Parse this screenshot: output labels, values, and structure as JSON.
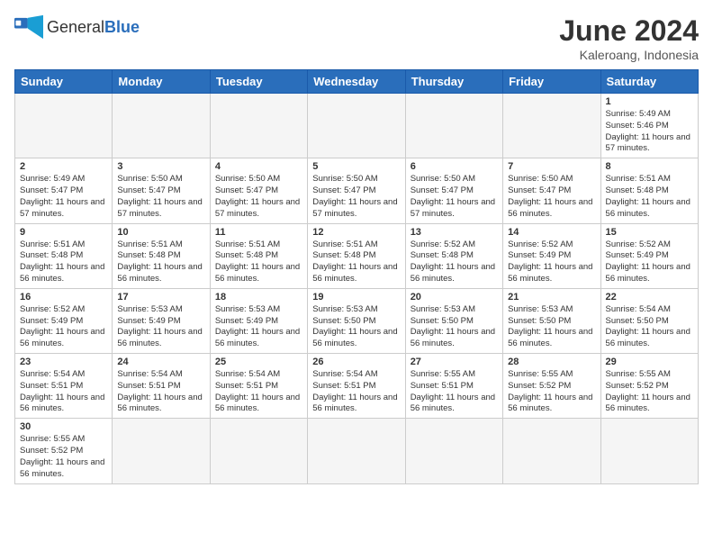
{
  "header": {
    "logo_text_normal": "General",
    "logo_text_bold": "Blue",
    "month_title": "June 2024",
    "subtitle": "Kaleroang, Indonesia"
  },
  "weekdays": [
    "Sunday",
    "Monday",
    "Tuesday",
    "Wednesday",
    "Thursday",
    "Friday",
    "Saturday"
  ],
  "weeks": [
    [
      {
        "day": "",
        "empty": true
      },
      {
        "day": "",
        "empty": true
      },
      {
        "day": "",
        "empty": true
      },
      {
        "day": "",
        "empty": true
      },
      {
        "day": "",
        "empty": true
      },
      {
        "day": "",
        "empty": true
      },
      {
        "day": "1",
        "sunrise": "5:49 AM",
        "sunset": "5:46 PM",
        "daylight": "11 hours and 57 minutes."
      }
    ],
    [
      {
        "day": "2",
        "sunrise": "5:49 AM",
        "sunset": "5:47 PM",
        "daylight": "11 hours and 57 minutes."
      },
      {
        "day": "3",
        "sunrise": "5:50 AM",
        "sunset": "5:47 PM",
        "daylight": "11 hours and 57 minutes."
      },
      {
        "day": "4",
        "sunrise": "5:50 AM",
        "sunset": "5:47 PM",
        "daylight": "11 hours and 57 minutes."
      },
      {
        "day": "5",
        "sunrise": "5:50 AM",
        "sunset": "5:47 PM",
        "daylight": "11 hours and 57 minutes."
      },
      {
        "day": "6",
        "sunrise": "5:50 AM",
        "sunset": "5:47 PM",
        "daylight": "11 hours and 57 minutes."
      },
      {
        "day": "7",
        "sunrise": "5:50 AM",
        "sunset": "5:47 PM",
        "daylight": "11 hours and 56 minutes."
      },
      {
        "day": "8",
        "sunrise": "5:51 AM",
        "sunset": "5:48 PM",
        "daylight": "11 hours and 56 minutes."
      }
    ],
    [
      {
        "day": "9",
        "sunrise": "5:51 AM",
        "sunset": "5:48 PM",
        "daylight": "11 hours and 56 minutes."
      },
      {
        "day": "10",
        "sunrise": "5:51 AM",
        "sunset": "5:48 PM",
        "daylight": "11 hours and 56 minutes."
      },
      {
        "day": "11",
        "sunrise": "5:51 AM",
        "sunset": "5:48 PM",
        "daylight": "11 hours and 56 minutes."
      },
      {
        "day": "12",
        "sunrise": "5:51 AM",
        "sunset": "5:48 PM",
        "daylight": "11 hours and 56 minutes."
      },
      {
        "day": "13",
        "sunrise": "5:52 AM",
        "sunset": "5:48 PM",
        "daylight": "11 hours and 56 minutes."
      },
      {
        "day": "14",
        "sunrise": "5:52 AM",
        "sunset": "5:49 PM",
        "daylight": "11 hours and 56 minutes."
      },
      {
        "day": "15",
        "sunrise": "5:52 AM",
        "sunset": "5:49 PM",
        "daylight": "11 hours and 56 minutes."
      }
    ],
    [
      {
        "day": "16",
        "sunrise": "5:52 AM",
        "sunset": "5:49 PM",
        "daylight": "11 hours and 56 minutes."
      },
      {
        "day": "17",
        "sunrise": "5:53 AM",
        "sunset": "5:49 PM",
        "daylight": "11 hours and 56 minutes."
      },
      {
        "day": "18",
        "sunrise": "5:53 AM",
        "sunset": "5:49 PM",
        "daylight": "11 hours and 56 minutes."
      },
      {
        "day": "19",
        "sunrise": "5:53 AM",
        "sunset": "5:50 PM",
        "daylight": "11 hours and 56 minutes."
      },
      {
        "day": "20",
        "sunrise": "5:53 AM",
        "sunset": "5:50 PM",
        "daylight": "11 hours and 56 minutes."
      },
      {
        "day": "21",
        "sunrise": "5:53 AM",
        "sunset": "5:50 PM",
        "daylight": "11 hours and 56 minutes."
      },
      {
        "day": "22",
        "sunrise": "5:54 AM",
        "sunset": "5:50 PM",
        "daylight": "11 hours and 56 minutes."
      }
    ],
    [
      {
        "day": "23",
        "sunrise": "5:54 AM",
        "sunset": "5:51 PM",
        "daylight": "11 hours and 56 minutes."
      },
      {
        "day": "24",
        "sunrise": "5:54 AM",
        "sunset": "5:51 PM",
        "daylight": "11 hours and 56 minutes."
      },
      {
        "day": "25",
        "sunrise": "5:54 AM",
        "sunset": "5:51 PM",
        "daylight": "11 hours and 56 minutes."
      },
      {
        "day": "26",
        "sunrise": "5:54 AM",
        "sunset": "5:51 PM",
        "daylight": "11 hours and 56 minutes."
      },
      {
        "day": "27",
        "sunrise": "5:55 AM",
        "sunset": "5:51 PM",
        "daylight": "11 hours and 56 minutes."
      },
      {
        "day": "28",
        "sunrise": "5:55 AM",
        "sunset": "5:52 PM",
        "daylight": "11 hours and 56 minutes."
      },
      {
        "day": "29",
        "sunrise": "5:55 AM",
        "sunset": "5:52 PM",
        "daylight": "11 hours and 56 minutes."
      }
    ],
    [
      {
        "day": "30",
        "sunrise": "5:55 AM",
        "sunset": "5:52 PM",
        "daylight": "11 hours and 56 minutes."
      },
      {
        "day": "",
        "empty": true
      },
      {
        "day": "",
        "empty": true
      },
      {
        "day": "",
        "empty": true
      },
      {
        "day": "",
        "empty": true
      },
      {
        "day": "",
        "empty": true
      },
      {
        "day": "",
        "empty": true
      }
    ]
  ],
  "labels": {
    "sunrise": "Sunrise:",
    "sunset": "Sunset:",
    "daylight": "Daylight:"
  }
}
